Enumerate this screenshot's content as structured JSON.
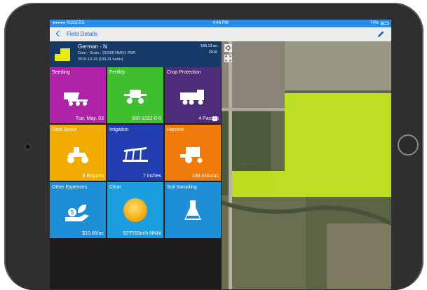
{
  "status_bar": {
    "carrier": "●●●●● ROGERS",
    "time": "4:46 PM",
    "battery": "74%"
  },
  "nav": {
    "back_label": "Field Details"
  },
  "field": {
    "name": "German - N",
    "crop": "Corn - Grain - 31G65 NMO1 PDR",
    "date": "2016-10-19 [139.31 bu/ac]",
    "acres": "185.13 ac",
    "year": "2016"
  },
  "tiles": [
    {
      "title": "Seeding",
      "value": "Tue. May. 03",
      "color": "#b022a8",
      "icon": "planter-icon"
    },
    {
      "title": "Fertility",
      "value": "300-1022-0-0",
      "color": "#3fbf2e",
      "icon": "sprayer-icon"
    },
    {
      "title": "Crop Protection",
      "value": "4 Passes",
      "badge": "1",
      "color": "#4e2c7a",
      "icon": "spreader-icon"
    },
    {
      "title": "Field Scout",
      "value": "8 Reports",
      "color": "#f2ac00",
      "icon": "atv-icon"
    },
    {
      "title": "Irrigation",
      "value": "7 inches",
      "color": "#233eb0",
      "icon": "pivot-irrigation-icon"
    },
    {
      "title": "Harvest",
      "value": "139.31bu/ac",
      "color": "#f07a0a",
      "icon": "combine-icon"
    },
    {
      "title": "Other Expenses",
      "value": "$10.00/ac",
      "color": "#1e8ed6",
      "icon": "money-plant-icon"
    },
    {
      "title": "Clear",
      "value": "52°F/15m/h NNW",
      "color": "#1b9ee0",
      "icon": "sun-icon"
    },
    {
      "title": "Soil Sampling",
      "value": "",
      "color": "#1e8ed6",
      "icon": "flask-icon"
    }
  ],
  "colors": {
    "status_bar": "#2a8ce6",
    "header": "#153a68",
    "field_overlay": "#c6e81e",
    "nav_tint": "#1e60b0"
  }
}
